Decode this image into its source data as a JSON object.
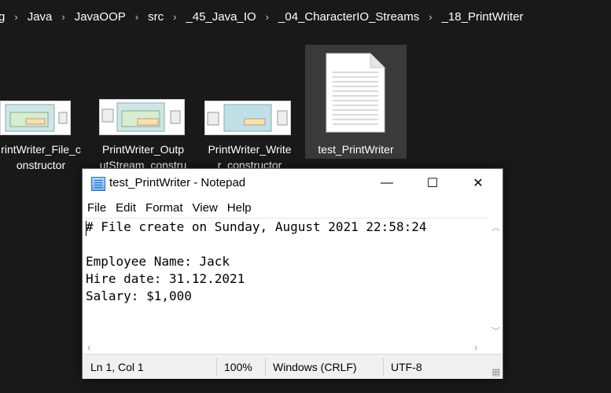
{
  "breadcrumb": {
    "items": [
      "g",
      "Java",
      "JavaOOP",
      "src",
      "_45_Java_IO",
      "_04_CharacterIO_Streams",
      "_18_PrintWriter"
    ],
    "separator": "›"
  },
  "files": [
    {
      "line1": "rintWriter_File_c",
      "line2": "onstructor",
      "icon": "diagram-thumbnail"
    },
    {
      "line1": "PrintWriter_Outp",
      "line2": "utStream_constru",
      "icon": "diagram-thumbnail"
    },
    {
      "line1": "PrintWriter_Write",
      "line2": "r_constructor",
      "icon": "diagram-thumbnail"
    },
    {
      "line1": "test_PrintWriter",
      "line2": "",
      "icon": "text-document-icon"
    }
  ],
  "notepad": {
    "title": "test_PrintWriter - Notepad",
    "controls": {
      "minimize": "—",
      "maximize": "☐",
      "close": "✕"
    },
    "menu": [
      "File",
      "Edit",
      "Format",
      "View",
      "Help"
    ],
    "content": "# File create on Sunday, August 2021 22:58:24\n\nEmployee Name: Jack\nHire date: 31.12.2021\nSalary: $1,000",
    "status": {
      "position": "Ln 1, Col 1",
      "zoom": "100%",
      "line_ending": "Windows (CRLF)",
      "encoding": "UTF-8"
    }
  }
}
